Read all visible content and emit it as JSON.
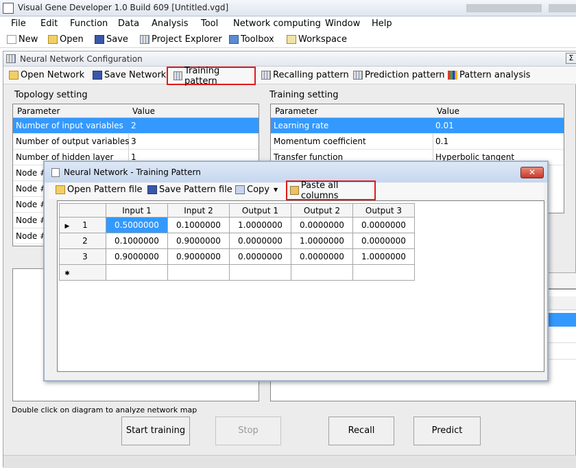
{
  "app": {
    "title": "Visual Gene Developer 1.0 Build 609   [Untitled.vgd]"
  },
  "menu": [
    "File",
    "Edit",
    "Function",
    "Data",
    "Analysis",
    "Tool",
    "Network computing",
    "Window",
    "Help"
  ],
  "main_toolbar": [
    "New",
    "Open",
    "Save",
    "Project Explorer",
    "Toolbox",
    "Workspace"
  ],
  "nn_window": {
    "title": "Neural Network Configuration",
    "toolbar": [
      "Open Network",
      "Save Network",
      "Training pattern",
      "Recalling pattern",
      "Prediction pattern",
      "Pattern analysis"
    ]
  },
  "topology": {
    "label": "Topology setting",
    "headers": [
      "Parameter",
      "Value"
    ],
    "rows": [
      [
        "Number of input variables",
        "2"
      ],
      [
        "Number of output variables",
        "3"
      ],
      [
        "Number of hidden layer",
        "1"
      ],
      [
        "Node #",
        ""
      ],
      [
        "Node #",
        ""
      ],
      [
        "Node #",
        ""
      ],
      [
        "Node #",
        ""
      ],
      [
        "Node #",
        ""
      ]
    ]
  },
  "training": {
    "label": "Training setting",
    "headers": [
      "Parameter",
      "Value"
    ],
    "rows": [
      [
        "Learning rate",
        "0.01"
      ],
      [
        "Momentum coefficient",
        "0.1"
      ],
      [
        "Transfer function",
        "Hyperbolic tangent"
      ]
    ]
  },
  "hint": "Double click on diagram to analyze network map",
  "buttons": {
    "start": "Start training",
    "stop": "Stop",
    "recall": "Recall",
    "predict": "Predict"
  },
  "dialog": {
    "title": "Neural Network - Training Pattern",
    "close": "✕",
    "toolbar": {
      "open": "Open Pattern file",
      "save": "Save Pattern file",
      "copy": "Copy",
      "paste": "Paste all columns"
    },
    "columns": [
      "Input 1",
      "Input 2",
      "Output 1",
      "Output 2",
      "Output 3"
    ],
    "rows": [
      {
        "n": "1",
        "values": [
          "0.5000000",
          "0.1000000",
          "1.0000000",
          "0.0000000",
          "0.0000000"
        ]
      },
      {
        "n": "2",
        "values": [
          "0.1000000",
          "0.9000000",
          "0.0000000",
          "1.0000000",
          "0.0000000"
        ]
      },
      {
        "n": "3",
        "values": [
          "0.9000000",
          "0.9000000",
          "0.0000000",
          "0.0000000",
          "1.0000000"
        ]
      }
    ],
    "current_marker": "▶",
    "new_row_marker": "✱"
  }
}
